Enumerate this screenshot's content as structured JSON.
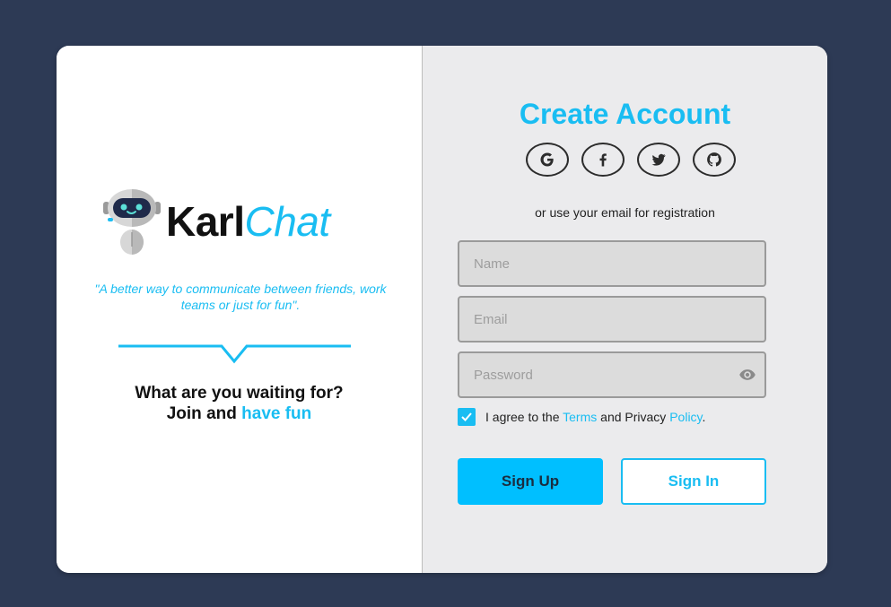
{
  "brand": {
    "logo_primary": "Karl",
    "logo_accent": "Chat",
    "tagline": "\"A better way to communicate between friends, work teams or just for fun\".",
    "cta_line1": "What are you waiting for?",
    "cta_line2_prefix": "Join and ",
    "cta_line2_highlight": "have fun"
  },
  "signup": {
    "title": "Create Account",
    "social_icons": [
      "google-icon",
      "facebook-icon",
      "twitter-icon",
      "github-icon"
    ],
    "alt_text": "or use your email for registration",
    "name_placeholder": "Name",
    "email_placeholder": "Email",
    "password_placeholder": "Password",
    "agree_checked": true,
    "agree_prefix": "I agree to the ",
    "terms_link": "Terms",
    "agree_middle": " and Privacy ",
    "policy_link": "Policy",
    "agree_suffix": ".",
    "signup_label": "Sign Up",
    "signin_label": "Sign In"
  },
  "colors": {
    "background": "#2d3a55",
    "accent": "#19bdf2",
    "panel_right": "#ebebed"
  }
}
